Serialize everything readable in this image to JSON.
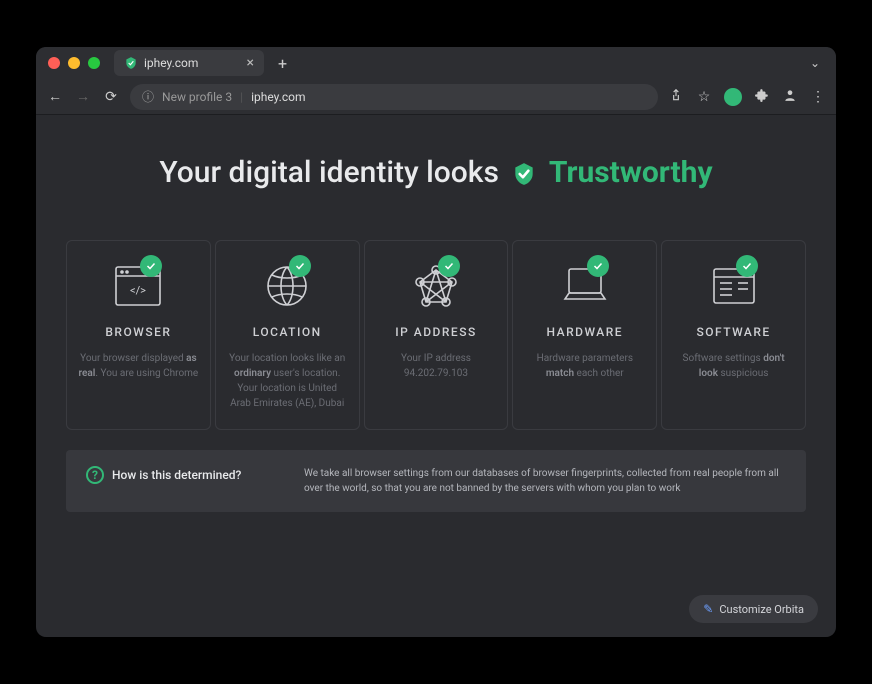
{
  "window": {
    "tab_title": "iphey.com",
    "profile_label": "New profile 3",
    "url": "iphey.com"
  },
  "headline": {
    "prefix": "Your digital identity looks",
    "status": "Trustworthy"
  },
  "cards": [
    {
      "title": "BROWSER",
      "desc_pre": "Your browser displayed ",
      "desc_bold": "as real",
      "desc_post": ". You are using Chrome"
    },
    {
      "title": "LOCATION",
      "desc_pre": "Your location looks like an ",
      "desc_bold": "ordinary",
      "desc_post": " user's location. Your location is United Arab Emirates (AE), Dubai"
    },
    {
      "title": "IP ADDRESS",
      "desc_pre": "Your IP address ",
      "desc_bold": "",
      "desc_post": "94.202.79.103"
    },
    {
      "title": "HARDWARE",
      "desc_pre": "Hardware parameters ",
      "desc_bold": "match",
      "desc_post": " each other"
    },
    {
      "title": "SOFTWARE",
      "desc_pre": "Software settings ",
      "desc_bold": "don't look",
      "desc_post": " suspicious"
    }
  ],
  "info": {
    "question": "How is this determined?",
    "answer": "We take all browser settings from our databases of browser fingerprints, collected from real people from all over the world, so that you are not banned by the servers with whom you plan to work"
  },
  "customize_label": "Customize Orbita",
  "colors": {
    "accent": "#32b877"
  }
}
